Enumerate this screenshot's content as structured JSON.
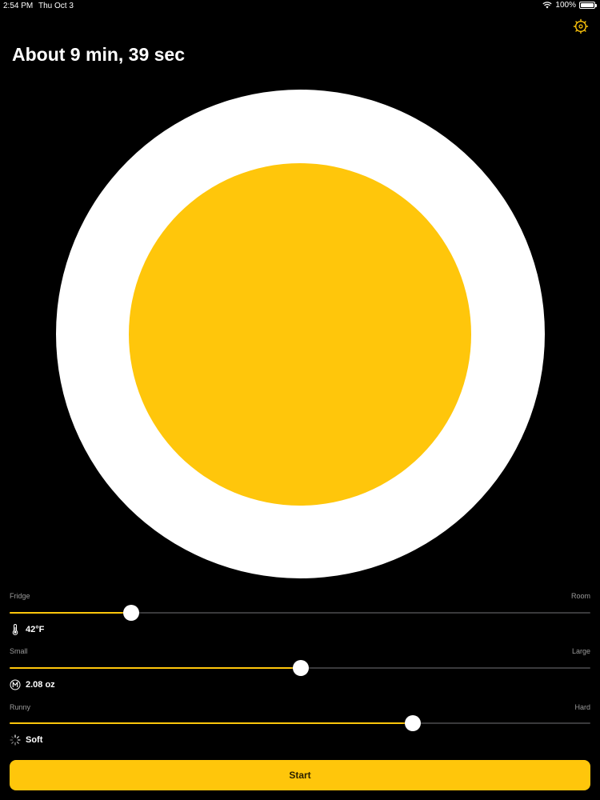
{
  "status_bar": {
    "time": "2:54 PM",
    "date": "Thu Oct 3",
    "battery": "100%"
  },
  "title": "About 9 min, 39 sec",
  "colors": {
    "accent": "#ffc60b",
    "background": "#000000",
    "egg_white": "#ffffff",
    "track": "#3a3a3c"
  },
  "sliders": {
    "temperature": {
      "min_label": "Fridge",
      "max_label": "Room",
      "value_fraction": 0.21,
      "value_text": "42°F",
      "icon": "thermometer-icon"
    },
    "size": {
      "min_label": "Small",
      "max_label": "Large",
      "value_fraction": 0.502,
      "value_text": "2.08 oz",
      "icon": "medium-size-icon"
    },
    "doneness": {
      "min_label": "Runny",
      "max_label": "Hard",
      "value_fraction": 0.694,
      "value_text": "Soft",
      "icon": "soft-spinner-icon"
    }
  },
  "start_button": {
    "label": "Start"
  },
  "settings_icon": "gear-icon"
}
